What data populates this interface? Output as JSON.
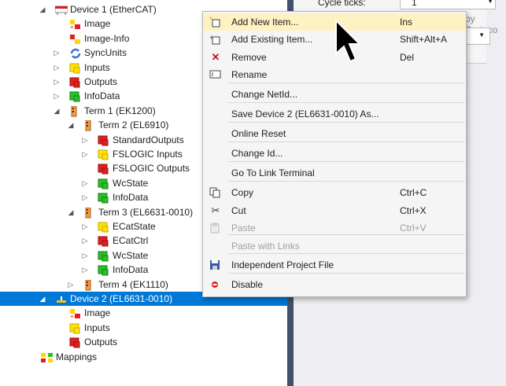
{
  "tree": {
    "rows": [
      {
        "label": "Device 1 (EtherCAT)",
        "expander": "down",
        "icon": "ethercat-device-icon"
      },
      {
        "label": "Image",
        "expander": "",
        "icon": "image-icon"
      },
      {
        "label": "Image-Info",
        "expander": "",
        "icon": "image-info-icon"
      },
      {
        "label": "SyncUnits",
        "expander": "right",
        "icon": "sync-units-icon"
      },
      {
        "label": "Inputs",
        "expander": "right",
        "icon": "inputs-icon"
      },
      {
        "label": "Outputs",
        "expander": "right",
        "icon": "outputs-icon"
      },
      {
        "label": "InfoData",
        "expander": "right",
        "icon": "infodata-icon"
      },
      {
        "label": "Term 1 (EK1200)",
        "expander": "down",
        "icon": "terminal-icon"
      },
      {
        "label": "Term 2 (EL6910)",
        "expander": "down",
        "icon": "terminal-icon"
      },
      {
        "label": "StandardOutputs",
        "expander": "right",
        "icon": "outputs-icon"
      },
      {
        "label": "FSLOGIC Inputs",
        "expander": "right",
        "icon": "inputs-icon"
      },
      {
        "label": "FSLOGIC Outputs",
        "expander": "",
        "icon": "outputs-icon"
      },
      {
        "label": "WcState",
        "expander": "right",
        "icon": "infodata-icon"
      },
      {
        "label": "InfoData",
        "expander": "right",
        "icon": "infodata-icon"
      },
      {
        "label": "Term 3 (EL6631-0010)",
        "expander": "down",
        "icon": "terminal-icon"
      },
      {
        "label": "ECatState",
        "expander": "right",
        "icon": "inputs-icon"
      },
      {
        "label": "ECatCtrl",
        "expander": "right",
        "icon": "outputs-icon"
      },
      {
        "label": "WcState",
        "expander": "right",
        "icon": "infodata-icon"
      },
      {
        "label": "InfoData",
        "expander": "right",
        "icon": "infodata-icon"
      },
      {
        "label": "Term 4 (EK1110)",
        "expander": "right",
        "icon": "terminal-icon"
      },
      {
        "label": "Device 2 (EL6631-0010)",
        "expander": "down",
        "icon": "profinet-device-icon",
        "selected": true
      },
      {
        "label": "Image",
        "expander": "",
        "icon": "image-icon"
      },
      {
        "label": "Inputs",
        "expander": "",
        "icon": "inputs-icon"
      },
      {
        "label": "Outputs",
        "expander": "",
        "icon": "outputs-icon"
      },
      {
        "label": "Mappings",
        "expander": "",
        "icon": "mappings-icon"
      }
    ]
  },
  "properties": {
    "cycle_ticks_label": "Cycle ticks:",
    "cycle_ticks_value": "1",
    "side_text": "by Protoco"
  },
  "menu": {
    "items": [
      {
        "label": "Add New Item...",
        "shortcut": "Ins",
        "icon": "add-new-item-icon",
        "highlighted": true
      },
      {
        "label": "Add Existing Item...",
        "shortcut": "Shift+Alt+A",
        "icon": "add-existing-item-icon"
      },
      {
        "label": "Remove",
        "shortcut": "Del",
        "icon": "remove-icon"
      },
      {
        "label": "Rename",
        "shortcut": "",
        "icon": "rename-icon"
      },
      {
        "label": "Change NetId...",
        "shortcut": "",
        "icon": ""
      },
      {
        "label": "Save Device 2 (EL6631-0010) As...",
        "shortcut": "",
        "icon": ""
      },
      {
        "label": "Online Reset",
        "shortcut": "",
        "icon": ""
      },
      {
        "label": "Change Id...",
        "shortcut": "",
        "icon": ""
      },
      {
        "label": "Go To Link Terminal",
        "shortcut": "",
        "icon": ""
      },
      {
        "label": "Copy",
        "shortcut": "Ctrl+C",
        "icon": "copy-icon"
      },
      {
        "label": "Cut",
        "shortcut": "Ctrl+X",
        "icon": "cut-icon"
      },
      {
        "label": "Paste",
        "shortcut": "Ctrl+V",
        "icon": "paste-icon",
        "disabled": true
      },
      {
        "label": "Paste with Links",
        "shortcut": "",
        "icon": "",
        "disabled": true
      },
      {
        "label": "Independent Project File",
        "shortcut": "",
        "icon": "save-file-icon"
      },
      {
        "label": "Disable",
        "shortcut": "",
        "icon": "disable-icon"
      }
    ]
  },
  "colors": {
    "selection": "#0078d7",
    "menu_highlight": "#fef2c2",
    "divider": "#43506b"
  }
}
